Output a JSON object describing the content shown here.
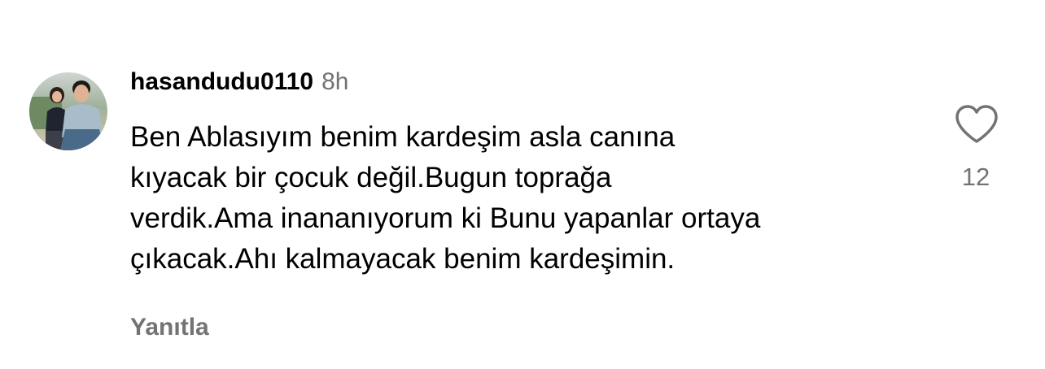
{
  "comment": {
    "username": "hasandudu0110",
    "timestamp": "8h",
    "lines": [
      "Ben Ablasıyım benim kardeşim asla canına",
      "kıyacak bir çocuk değil.Bugun toprağa",
      "verdik.Ama inananıyorum ki Bunu yapanlar ortaya",
      "çıkacak.Ahı kalmayacak benim kardeşimin."
    ],
    "reply_label": "Yanıtla",
    "like_count": "12"
  },
  "icons": {
    "avatar": "profile-photo",
    "like": "heart-outline-icon"
  },
  "colors": {
    "text": "#000000",
    "secondary": "#737373"
  }
}
